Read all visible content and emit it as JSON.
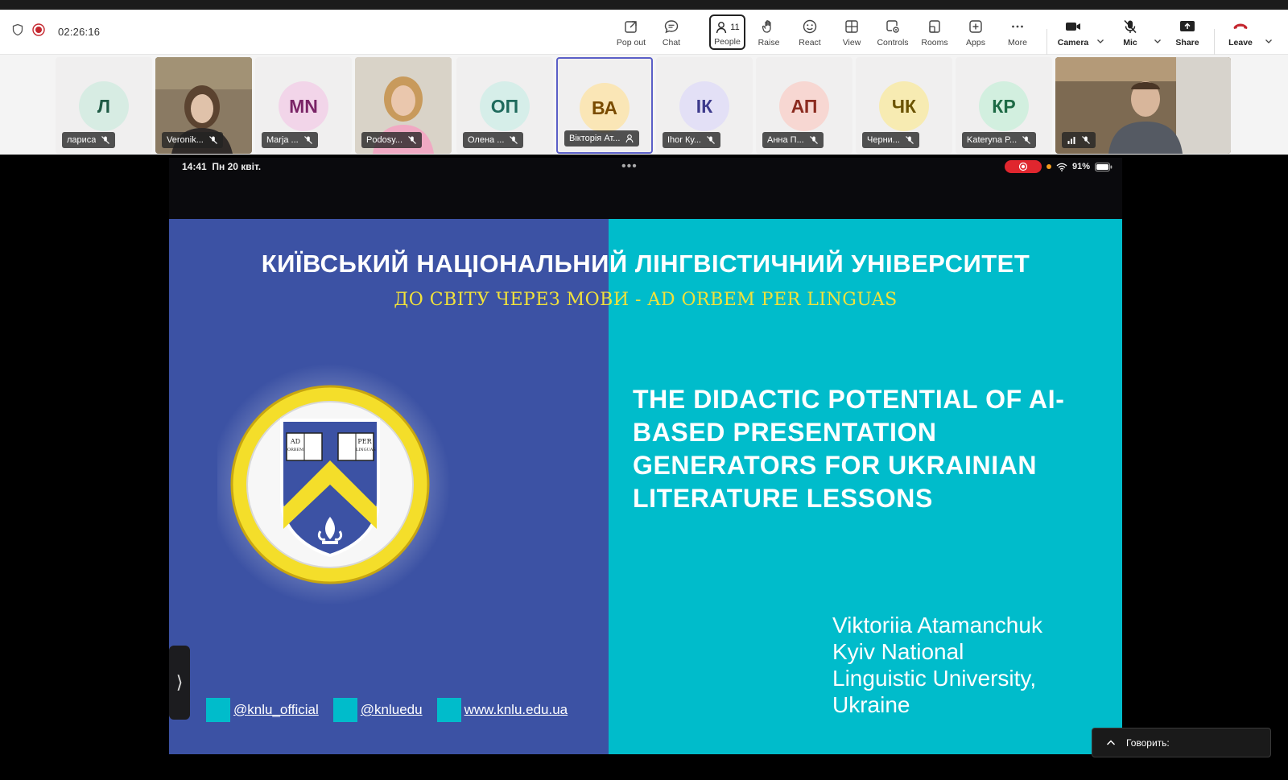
{
  "meeting": {
    "timer": "02:26:16",
    "toolbar": [
      {
        "id": "popout",
        "label": "Pop out",
        "icon": "pop-out-icon"
      },
      {
        "id": "chat",
        "label": "Chat",
        "icon": "chat-icon"
      },
      {
        "id": "people",
        "label": "People",
        "icon": "people-icon",
        "count": "11"
      },
      {
        "id": "raise",
        "label": "Raise",
        "icon": "raise-hand-icon"
      },
      {
        "id": "react",
        "label": "React",
        "icon": "react-smiley-icon"
      },
      {
        "id": "view",
        "label": "View",
        "icon": "view-grid-icon"
      },
      {
        "id": "controls",
        "label": "Controls",
        "icon": "controls-icon"
      },
      {
        "id": "rooms",
        "label": "Rooms",
        "icon": "rooms-icon"
      },
      {
        "id": "apps",
        "label": "Apps",
        "icon": "apps-plus-icon"
      },
      {
        "id": "more",
        "label": "More",
        "icon": "more-dots-icon"
      },
      {
        "id": "camera",
        "label": "Camera",
        "icon": "camera-icon"
      },
      {
        "id": "mic",
        "label": "Mic",
        "icon": "mic-muted-icon"
      },
      {
        "id": "share",
        "label": "Share",
        "icon": "share-icon"
      },
      {
        "id": "leave",
        "label": "Leave",
        "icon": "leave-phone-icon"
      }
    ]
  },
  "participants": [
    {
      "initials": "Л",
      "name": "лариса",
      "type": "avatar",
      "bg": "#d7ece3",
      "fg": "#1f5b45"
    },
    {
      "initials": "",
      "name": "Veronik...",
      "type": "video",
      "bg": "#7b6a55"
    },
    {
      "initials": "MN",
      "name": "Marja ...",
      "type": "avatar",
      "bg": "#f2d5e9",
      "fg": "#7a2466"
    },
    {
      "initials": "",
      "name": "Podosy...",
      "type": "video",
      "bg": "#cfc6b5"
    },
    {
      "initials": "ОП",
      "name": "Олена ...",
      "type": "avatar",
      "bg": "#d6eee9",
      "fg": "#1e6a5c"
    },
    {
      "initials": "ВА",
      "name": "Вікторія Ат...",
      "type": "avatar",
      "bg": "#fae6b6",
      "fg": "#7a4c00",
      "active": true
    },
    {
      "initials": "ІК",
      "name": "Ihor Ку...",
      "type": "avatar",
      "bg": "#e3e0f6",
      "fg": "#3d3a8c"
    },
    {
      "initials": "АП",
      "name": "Анна П...",
      "type": "avatar",
      "bg": "#f7d7d2",
      "fg": "#8b2a1f"
    },
    {
      "initials": "ЧК",
      "name": "Черни...",
      "type": "avatar",
      "bg": "#f7ebb2",
      "fg": "#6b5300"
    },
    {
      "initials": "КР",
      "name": "Kateryna P...",
      "type": "avatar",
      "bg": "#d2efdf",
      "fg": "#1d6a45"
    },
    {
      "initials": "",
      "name": "",
      "type": "video",
      "bg": "#6b5a45"
    }
  ],
  "ipad": {
    "time": "14:41",
    "date": "Пн 20 квіт.",
    "battery": "91%"
  },
  "slide": {
    "university": "КИЇВСЬКИЙ НАЦІОНАЛЬНИЙ ЛІНГВІСТИЧНИЙ УНІВЕРСИТЕТ",
    "motto": "ДО СВІТУ ЧЕРЕЗ МОВИ - AD ORBEM PER LINGUAS",
    "crest_text": [
      "AD",
      "ORBEM",
      "PER",
      "LINGUAS"
    ],
    "talk_title": "THE DIDACTIC POTENTIAL OF AI-BASED PRESENTATION GENERATORS FOR UKRAINIAN LITERATURE LESSONS",
    "author_lines": [
      "Viktoriia Atamanchuk",
      "Kyiv National",
      "Linguistic University,",
      "Ukraine"
    ],
    "socials": [
      "@knlu_official",
      "@knluedu",
      "www.knlu.edu.ua"
    ],
    "colors": {
      "left": "#3c52a4",
      "right": "#00bccb",
      "motto": "#f2e23a"
    }
  },
  "speaking": {
    "label": "Говорить:"
  }
}
